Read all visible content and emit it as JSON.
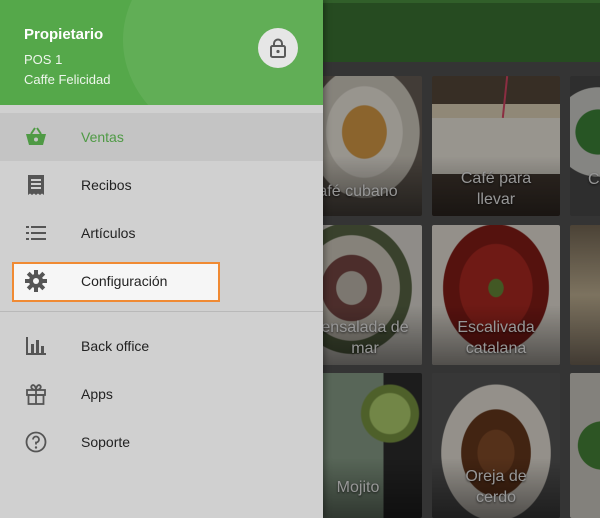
{
  "drawer": {
    "owner": "Propietario",
    "pos": "POS 1",
    "store": "Caffe Felicidad",
    "lock_icon": "lock-icon",
    "accent": "#55a84a"
  },
  "menu": {
    "items": [
      {
        "label": "Ventas",
        "icon": "basket-icon"
      },
      {
        "label": "Recibos",
        "icon": "receipt-icon"
      },
      {
        "label": "Artículos",
        "icon": "list-icon"
      },
      {
        "label": "Configuración",
        "icon": "gear-icon"
      },
      {
        "label": "Back office",
        "icon": "bar-chart-icon"
      },
      {
        "label": "Apps",
        "icon": "gift-icon"
      },
      {
        "label": "Soporte",
        "icon": "help-circle-icon"
      }
    ],
    "highlight_color": "#f08a33"
  },
  "tiles": [
    {
      "name": "afé cubano"
    },
    {
      "name": "Café para llevar"
    },
    {
      "name": "C"
    },
    {
      "name": "ensalada de mar"
    },
    {
      "name": "Escalivada catalana"
    },
    {
      "name": "Mojito"
    },
    {
      "name": "Oreja de cerdo"
    }
  ]
}
